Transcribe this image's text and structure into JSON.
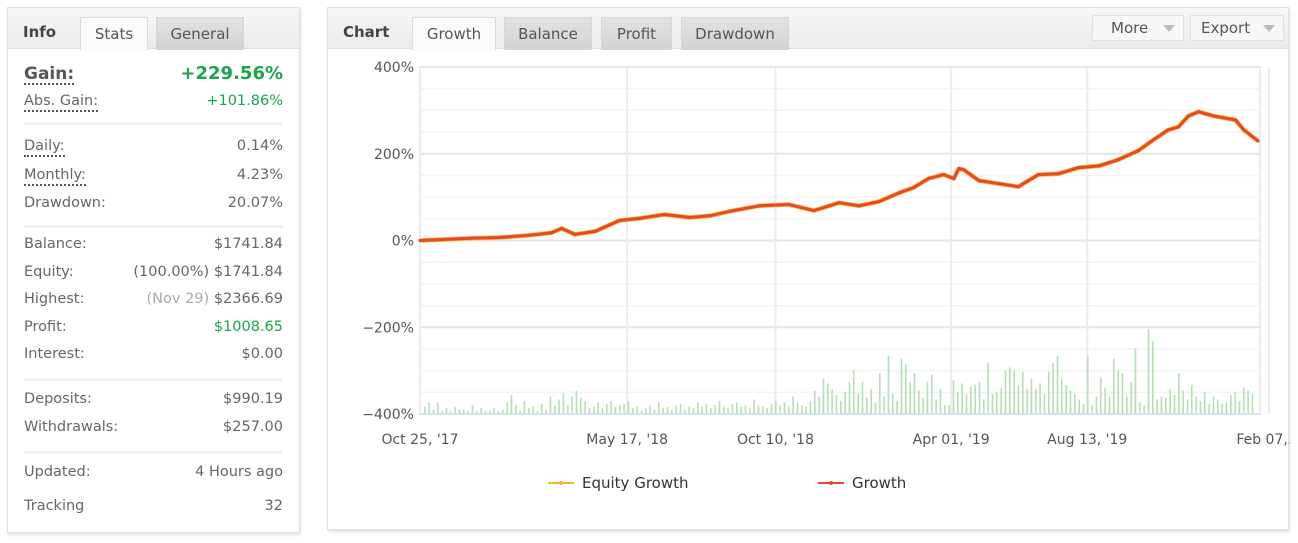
{
  "info_panel": {
    "heading": "Info",
    "tabs": [
      {
        "label": "Stats",
        "active": true
      },
      {
        "label": "General",
        "active": false
      }
    ],
    "gain": {
      "label": "Gain:",
      "value": "+229.56%"
    },
    "abs_gain": {
      "label": "Abs. Gain:",
      "value": "+101.86%"
    },
    "daily": {
      "label": "Daily:",
      "value": "0.14%"
    },
    "monthly": {
      "label": "Monthly:",
      "value": "4.23%"
    },
    "drawdown": {
      "label": "Drawdown:",
      "value": "20.07%"
    },
    "balance": {
      "label": "Balance:",
      "value": "$1741.84"
    },
    "equity": {
      "label": "Equity:",
      "note": "(100.00%)",
      "value": "$1741.84"
    },
    "highest": {
      "label": "Highest:",
      "note": "(Nov 29)",
      "value": "$2366.69"
    },
    "profit": {
      "label": "Profit:",
      "value": "$1008.65"
    },
    "interest": {
      "label": "Interest:",
      "value": "$0.00"
    },
    "deposits": {
      "label": "Deposits:",
      "value": "$990.19"
    },
    "withdrawals": {
      "label": "Withdrawals:",
      "value": "$257.00"
    },
    "updated": {
      "label": "Updated:",
      "value": "4 Hours ago"
    },
    "tracking": {
      "label": "Tracking",
      "value": "32"
    }
  },
  "chart_panel": {
    "heading": "Chart",
    "tabs": [
      {
        "label": "Growth",
        "active": true
      },
      {
        "label": "Balance",
        "active": false
      },
      {
        "label": "Profit",
        "active": false
      },
      {
        "label": "Drawdown",
        "active": false
      }
    ],
    "more_label": "More",
    "export_label": "Export"
  },
  "colors": {
    "growth": "#e8472b",
    "equity_growth": "#f5b82a",
    "bars": "#b5e0b5",
    "gain_green": "#1aa64b",
    "grid": "#ececec"
  },
  "chart_data": {
    "type": "line",
    "title": "",
    "xlabel": "",
    "ylabel": "",
    "ylim": [
      -400,
      400
    ],
    "yticks": [
      400,
      200,
      0,
      -200,
      -400
    ],
    "ytick_labels": [
      "400%",
      "200%",
      "0%",
      "-200%",
      "-400%"
    ],
    "y_minor_step": 50,
    "xlim_days": [
      0,
      825
    ],
    "xticks": [
      {
        "day": 0,
        "label": "Oct 25, '17"
      },
      {
        "day": 204,
        "label": "May 17, '18"
      },
      {
        "day": 350,
        "label": "Oct 10, '18"
      },
      {
        "day": 523,
        "label": "Apr 01, '19"
      },
      {
        "day": 657,
        "label": "Aug 13, '19"
      },
      {
        "day": 836,
        "label": "Feb 07,…"
      }
    ],
    "grid": true,
    "legend": {
      "position": "bottom",
      "entries": [
        "Equity Growth",
        "Growth"
      ]
    },
    "series": [
      {
        "name": "Growth",
        "x_frac": [
          0,
          0.024,
          0.06,
          0.095,
          0.131,
          0.157,
          0.169,
          0.185,
          0.209,
          0.238,
          0.262,
          0.292,
          0.322,
          0.346,
          0.369,
          0.405,
          0.44,
          0.47,
          0.5,
          0.524,
          0.548,
          0.572,
          0.589,
          0.607,
          0.625,
          0.637,
          0.643,
          0.649,
          0.667,
          0.691,
          0.714,
          0.738,
          0.762,
          0.786,
          0.81,
          0.833,
          0.857,
          0.875,
          0.893,
          0.905,
          0.917,
          0.929,
          0.947,
          0.973,
          0.983,
          1.0
        ],
        "values": [
          0,
          2,
          5,
          7,
          12,
          18,
          28,
          14,
          21,
          46,
          51,
          60,
          53,
          57,
          67,
          80,
          83,
          69,
          87,
          80,
          90,
          110,
          122,
          143,
          152,
          143,
          166,
          163,
          138,
          131,
          124,
          152,
          154,
          168,
          172,
          186,
          207,
          232,
          255,
          262,
          287,
          297,
          287,
          278,
          255,
          229.56
        ]
      },
      {
        "name": "Equity Growth",
        "note": "overlaps Growth line",
        "values": []
      },
      {
        "name": "Daily profit bars (unlabeled)",
        "type": "bar",
        "relative_heights": [
          0.05,
          0.08,
          0.03,
          0.08,
          0.02,
          0.04,
          0.02,
          0.05,
          0.03,
          0.03,
          0.02,
          0.06,
          0.02,
          0.04,
          0.02,
          0.02,
          0.04,
          0.02,
          0.03,
          0.08,
          0.13,
          0.06,
          0.02,
          0.09,
          0.04,
          0.05,
          0.02,
          0.07,
          0.03,
          0.12,
          0.06,
          0.1,
          0.14,
          0.06,
          0.12,
          0.16,
          0.11,
          0.09,
          0.04,
          0.05,
          0.08,
          0.04,
          0.07,
          0.09,
          0.05,
          0.06,
          0.07,
          0.09,
          0.04,
          0.05,
          0.02,
          0.04,
          0.06,
          0.03,
          0.08,
          0.04,
          0.05,
          0.03,
          0.06,
          0.07,
          0.03,
          0.05,
          0.04,
          0.08,
          0.05,
          0.07,
          0.04,
          0.06,
          0.09,
          0.05,
          0.04,
          0.07,
          0.08,
          0.05,
          0.06,
          0.04,
          0.1,
          0.06,
          0.05,
          0.04,
          0.07,
          0.09,
          0.06,
          0.08,
          0.05,
          0.12,
          0.08,
          0.06,
          0.05,
          0.09,
          0.16,
          0.12,
          0.24,
          0.21,
          0.17,
          0.13,
          0.09,
          0.15,
          0.22,
          0.3,
          0.14,
          0.22,
          0.11,
          0.17,
          0.08,
          0.28,
          0.12,
          0.4,
          0.14,
          0.09,
          0.38,
          0.34,
          0.22,
          0.28,
          0.16,
          0.11,
          0.22,
          0.27,
          0.1,
          0.17,
          0.06,
          0.06,
          0.23,
          0.15,
          0.21,
          0.14,
          0.19,
          0.2,
          0.22,
          0.1,
          0.35,
          0.14,
          0.15,
          0.18,
          0.3,
          0.32,
          0.3,
          0.2,
          0.29,
          0.17,
          0.24,
          0.17,
          0.21,
          0.14,
          0.29,
          0.35,
          0.4,
          0.24,
          0.2,
          0.16,
          0.14,
          0.1,
          0.07,
          0.4,
          0.06,
          0.12,
          0.25,
          0.18,
          0.12,
          0.38,
          0.3,
          0.28,
          0.12,
          0.22,
          0.45,
          0.08,
          0.06,
          0.58,
          0.5,
          0.1,
          0.12,
          0.11,
          0.17,
          0.13,
          0.28,
          0.16,
          0.1,
          0.2,
          0.12,
          0.09,
          0.15,
          0.07,
          0.12,
          0.1,
          0.07,
          0.08,
          0.13,
          0.15,
          0.09,
          0.18,
          0.16,
          0.14
        ]
      }
    ]
  }
}
